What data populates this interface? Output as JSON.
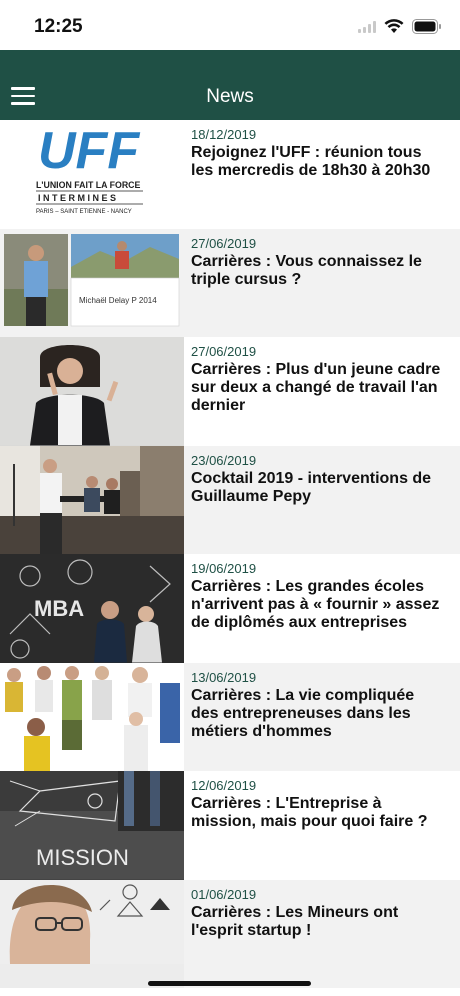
{
  "status_bar": {
    "time": "12:25"
  },
  "nav": {
    "title": "News",
    "menu_icon": "hamburger-menu-icon"
  },
  "colors": {
    "nav_bg": "#1f5045",
    "accent": "#1f5045"
  },
  "logo": {
    "big_text": "UFF",
    "line1": "L'UNION FAIT LA FORCE",
    "line2": "I N T E R M I N E S",
    "line3": "PARIS – SAINT ETIENNE - NANCY"
  },
  "news": [
    {
      "date": "18/12/2019",
      "title": "Rejoignez l'UFF : réunion tous les mercredis de 18h30 à 20h30"
    },
    {
      "date": "27/06/2019",
      "title": "Carrières : Vous connaissez le triple cursus ?",
      "image_caption": "Michaël Delay P 2014"
    },
    {
      "date": "27/06/2019",
      "title": "Carrières : Plus d'un jeune cadre sur deux a changé de travail l'an dernier"
    },
    {
      "date": "23/06/2019",
      "title": "Cocktail 2019 - interventions de Guillaume Pepy"
    },
    {
      "date": "19/06/2019",
      "title": "Carrières : Les grandes écoles n'arrivent pas à « fournir » assez de diplômés aux entreprises",
      "image_text": "MBA"
    },
    {
      "date": "13/06/2019",
      "title": "Carrières : La vie compliquée des entrepreneuses dans les métiers d'hommes"
    },
    {
      "date": "12/06/2019",
      "title": "Carrières : L'Entreprise à mission, mais pour quoi faire ?",
      "image_text": "MISSION"
    },
    {
      "date": "01/06/2019",
      "title": "Carrières : Les Mineurs ont l'esprit startup !"
    }
  ]
}
